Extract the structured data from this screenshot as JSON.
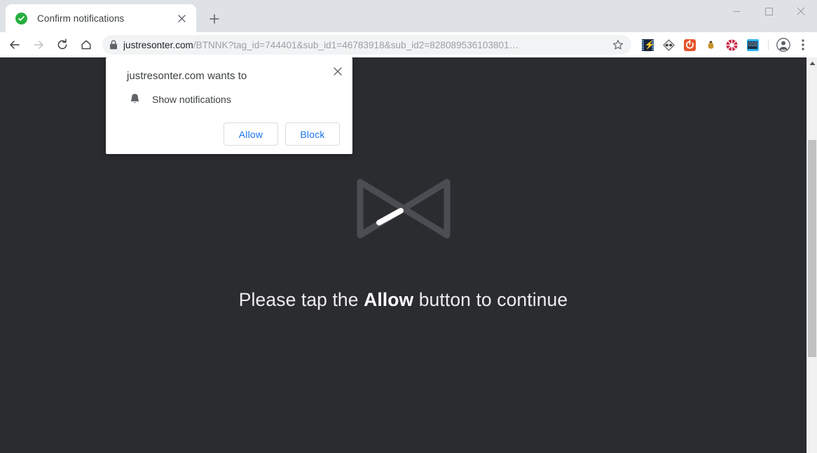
{
  "window": {
    "controls": [
      {
        "name": "minimize",
        "glyph": "minimize-icon"
      },
      {
        "name": "maximize",
        "glyph": "maximize-icon"
      },
      {
        "name": "close",
        "glyph": "close-icon"
      }
    ]
  },
  "tabstrip": {
    "tabs": [
      {
        "title": "Confirm notifications",
        "favicon": "green-check-icon",
        "active": true
      }
    ],
    "close_tab_label": "×",
    "new_tab_label": "+"
  },
  "toolbar": {
    "back_icon": "back-arrow-icon",
    "forward_icon": "forward-arrow-icon",
    "reload_icon": "reload-icon",
    "home_icon": "home-icon",
    "omnibox": {
      "security_icon": "lock-icon",
      "host": "justresonter.com",
      "path": "/BTNNK?tag_id=744401&sub_id1=46783918&sub_id2=828089536103801…",
      "full_url": "justresonter.com/BTNNK?tag_id=744401&sub_id1=46783918&sub_id2=828089536103801…",
      "bookmark_icon": "star-icon"
    },
    "extensions": [
      {
        "name": "extension-film-strip-blue",
        "color": "#1f3a63",
        "accent": "#4a90d9"
      },
      {
        "name": "extension-diamond-gray",
        "color": "#e8e8e8",
        "accent": "#4a4a4a"
      },
      {
        "name": "extension-orange-square",
        "color": "#e8552d",
        "accent": "#ffffff"
      },
      {
        "name": "extension-money-bag",
        "color": "#f2f2f2",
        "accent": "#c8922a"
      },
      {
        "name": "extension-red-circle",
        "color": "#c62a4a",
        "accent": "#ffffff"
      },
      {
        "name": "extension-blue-film",
        "color": "#2fb3ef",
        "accent": "#15283c"
      }
    ],
    "profile_icon": "account-avatar-icon",
    "menu_icon": "three-dot-menu-icon"
  },
  "permission_bubble": {
    "title": "justresonter.com wants to",
    "permission_icon": "bell-icon",
    "permission_label": "Show notifications",
    "allow_label": "Allow",
    "block_label": "Block",
    "close_label": "×"
  },
  "page": {
    "background_color": "#2b2c30",
    "spinner_icon": "bowtie-loader-icon",
    "headline_prefix": "Please tap the ",
    "headline_emphasis": "Allow",
    "headline_suffix": " button to continue"
  },
  "scrollbar": {
    "up_arrow_icon": "scroll-up-arrow-icon",
    "thumb_label": "scrollbar-thumb"
  }
}
